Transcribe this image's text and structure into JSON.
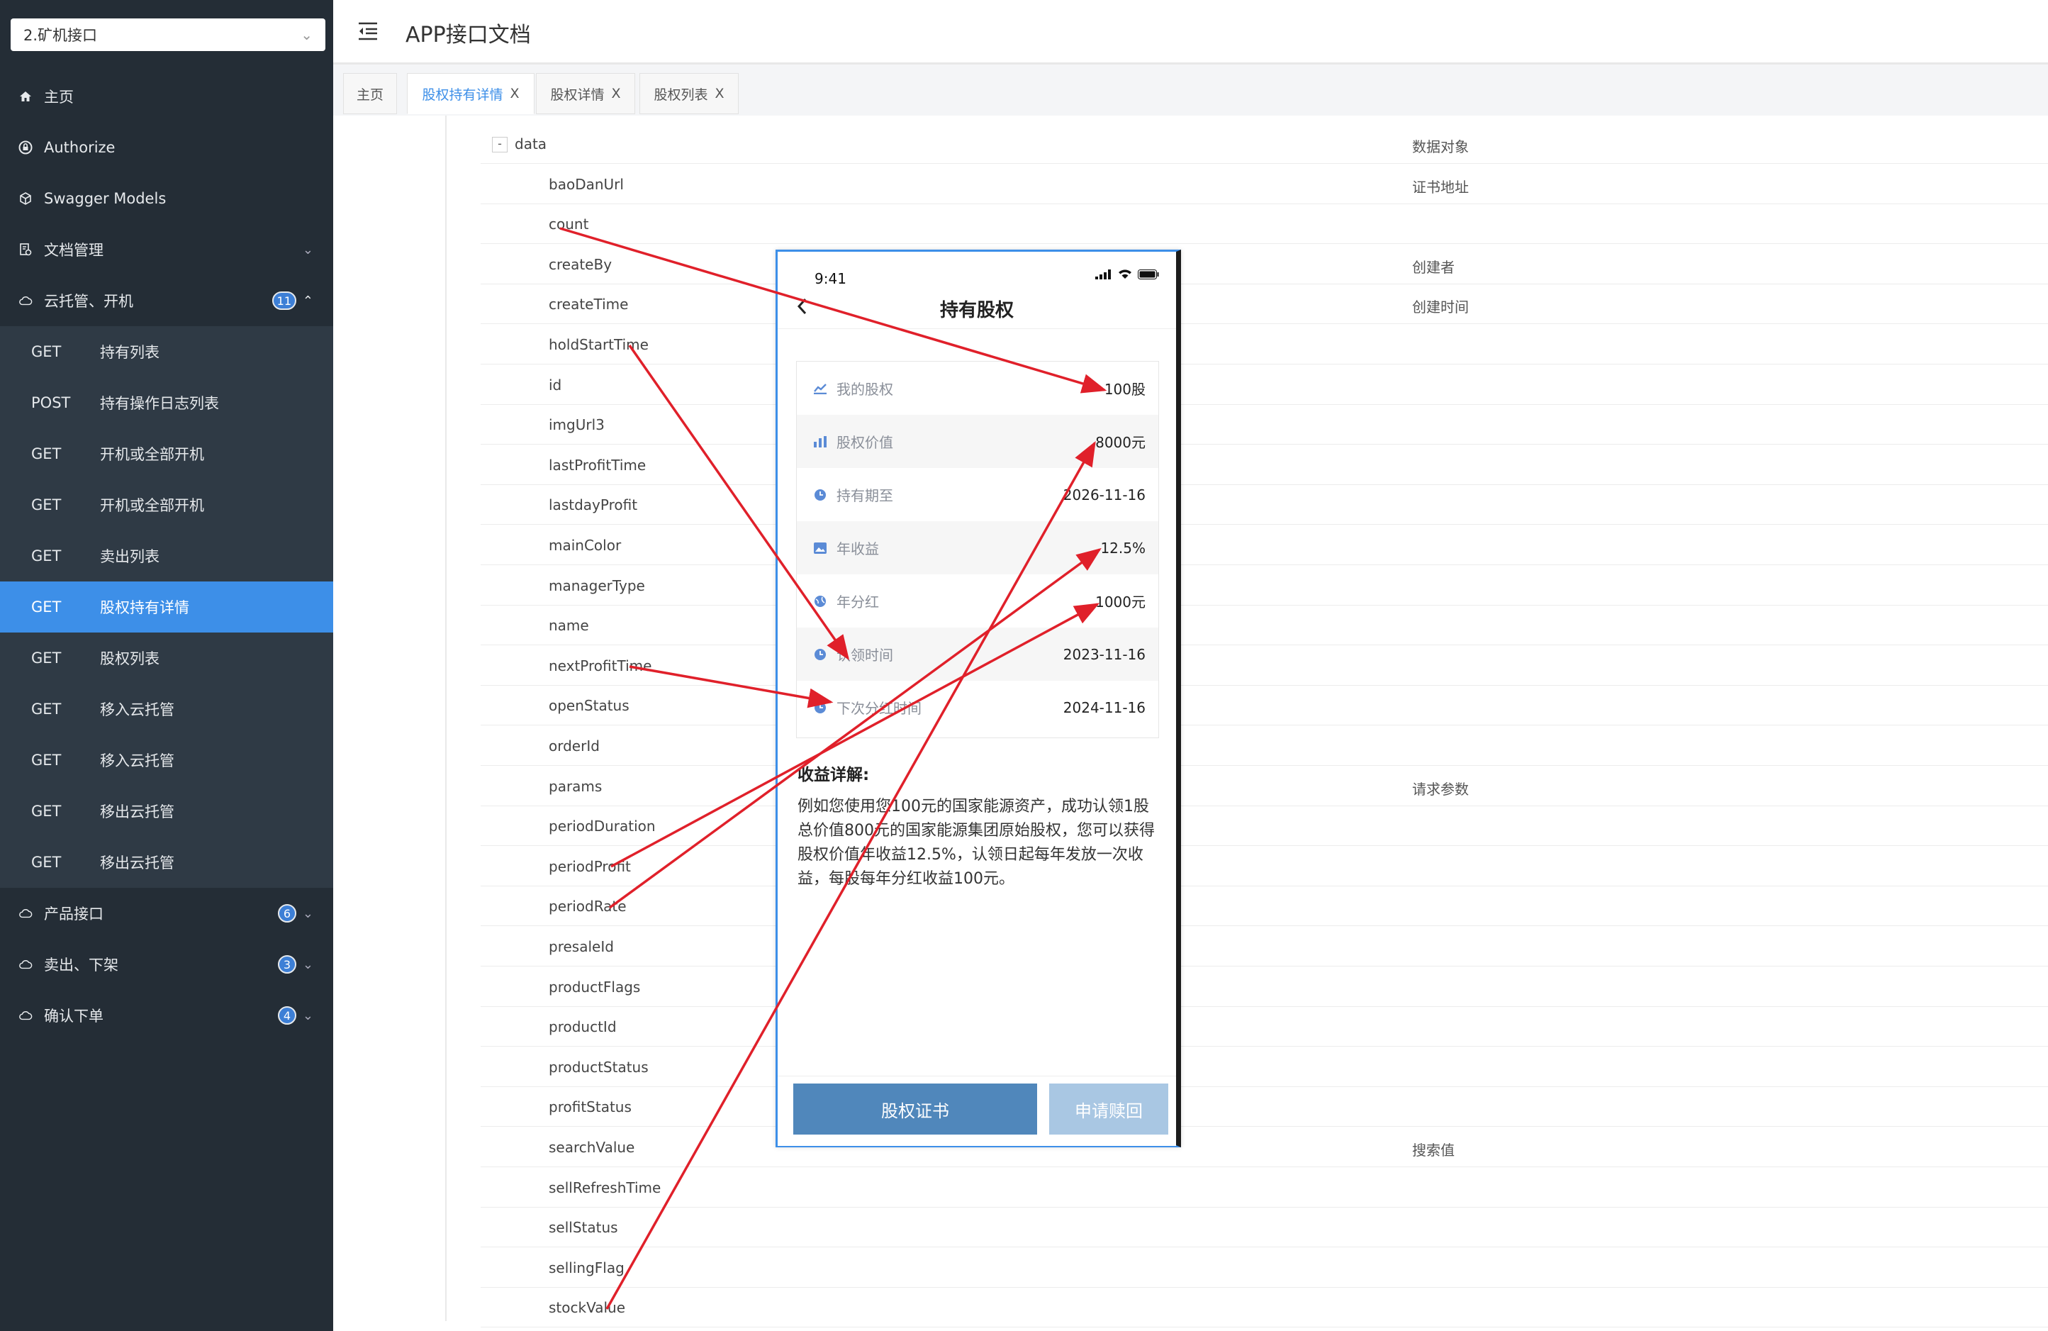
{
  "project_select": {
    "value": "2.矿机接口"
  },
  "sidebar": {
    "items": [
      {
        "label": "主页"
      },
      {
        "label": "Authorize"
      },
      {
        "label": "Swagger Models"
      },
      {
        "label": "文档管理"
      },
      {
        "label": "云托管、开机",
        "badge": "11"
      }
    ],
    "subitems": [
      {
        "method": "GET",
        "label": "持有列表"
      },
      {
        "method": "POST",
        "label": "持有操作日志列表"
      },
      {
        "method": "GET",
        "label": "开机或全部开机"
      },
      {
        "method": "GET",
        "label": "开机或全部开机"
      },
      {
        "method": "GET",
        "label": "卖出列表"
      },
      {
        "method": "GET",
        "label": "股权持有详情"
      },
      {
        "method": "GET",
        "label": "股权列表"
      },
      {
        "method": "GET",
        "label": "移入云托管"
      },
      {
        "method": "GET",
        "label": "移入云托管"
      },
      {
        "method": "GET",
        "label": "移出云托管"
      },
      {
        "method": "GET",
        "label": "移出云托管"
      }
    ],
    "groups": [
      {
        "label": "产品接口",
        "badge": "6"
      },
      {
        "label": "卖出、下架",
        "badge": "3"
      },
      {
        "label": "确认下单",
        "badge": "4"
      }
    ]
  },
  "header": {
    "title": "APP接口文档"
  },
  "tabs": [
    {
      "label": "主页"
    },
    {
      "label": "股权持有详情",
      "close": "X"
    },
    {
      "label": "股权详情",
      "close": "X"
    },
    {
      "label": "股权列表",
      "close": "X"
    }
  ],
  "fields": [
    {
      "name": "data",
      "desc": "数据对象",
      "toggle": "-"
    },
    {
      "name": "baoDanUrl",
      "desc": "证书地址"
    },
    {
      "name": "count",
      "desc": ""
    },
    {
      "name": "createBy",
      "desc": "创建者"
    },
    {
      "name": "createTime",
      "desc": "创建时间"
    },
    {
      "name": "holdStartTime",
      "desc": ""
    },
    {
      "name": "id",
      "desc": ""
    },
    {
      "name": "imgUrl3",
      "desc": ""
    },
    {
      "name": "lastProfitTime",
      "desc": ""
    },
    {
      "name": "lastdayProfit",
      "desc": ""
    },
    {
      "name": "mainColor",
      "desc": ""
    },
    {
      "name": "managerType",
      "desc": ""
    },
    {
      "name": "name",
      "desc": ""
    },
    {
      "name": "nextProfitTime",
      "desc": ""
    },
    {
      "name": "openStatus",
      "desc": ""
    },
    {
      "name": "orderId",
      "desc": ""
    },
    {
      "name": "params",
      "desc": "请求参数"
    },
    {
      "name": "periodDuration",
      "desc": ""
    },
    {
      "name": "periodProfit",
      "desc": ""
    },
    {
      "name": "periodRate",
      "desc": ""
    },
    {
      "name": "presaleId",
      "desc": ""
    },
    {
      "name": "productFlags",
      "desc": ""
    },
    {
      "name": "productId",
      "desc": ""
    },
    {
      "name": "productStatus",
      "desc": ""
    },
    {
      "name": "profitStatus",
      "desc": ""
    },
    {
      "name": "searchValue",
      "desc": "搜索值"
    },
    {
      "name": "sellRefreshTime",
      "desc": ""
    },
    {
      "name": "sellStatus",
      "desc": ""
    },
    {
      "name": "sellingFlag",
      "desc": ""
    },
    {
      "name": "stockValue",
      "desc": ""
    }
  ],
  "phone": {
    "time": "9:41",
    "title": "持有股权",
    "rows": [
      {
        "label": "我的股权",
        "value": "100股",
        "icon": "chart-icon"
      },
      {
        "label": "股权价值",
        "value": "8000元",
        "icon": "bar-chart-icon"
      },
      {
        "label": "持有期至",
        "value": "2026-11-16",
        "icon": "clock-icon"
      },
      {
        "label": "年收益",
        "value": "12.5%",
        "icon": "image-icon"
      },
      {
        "label": "年分红",
        "value": "1000元",
        "icon": "globe-icon"
      },
      {
        "label": "认领时间",
        "value": "2023-11-16",
        "icon": "clock-icon"
      },
      {
        "label": "下次分红时间",
        "value": "2024-11-16",
        "icon": "clock-icon"
      }
    ],
    "explain_title": "收益详解:",
    "explain_text": "例如您使用您100元的国家能源资产，成功认领1股总价值800元的国家能源集团原始股权，您可以获得股权价值年收益12.5%，认领日起每年发放一次收益，每股每年分红收益100元。",
    "button_primary": "股权证书",
    "button_secondary": "申请赎回"
  },
  "colors": {
    "sidebar_bg": "#242d36",
    "active_item": "#3d8fe8",
    "arrow": "#e0202a",
    "primary_button": "#5087bb"
  }
}
